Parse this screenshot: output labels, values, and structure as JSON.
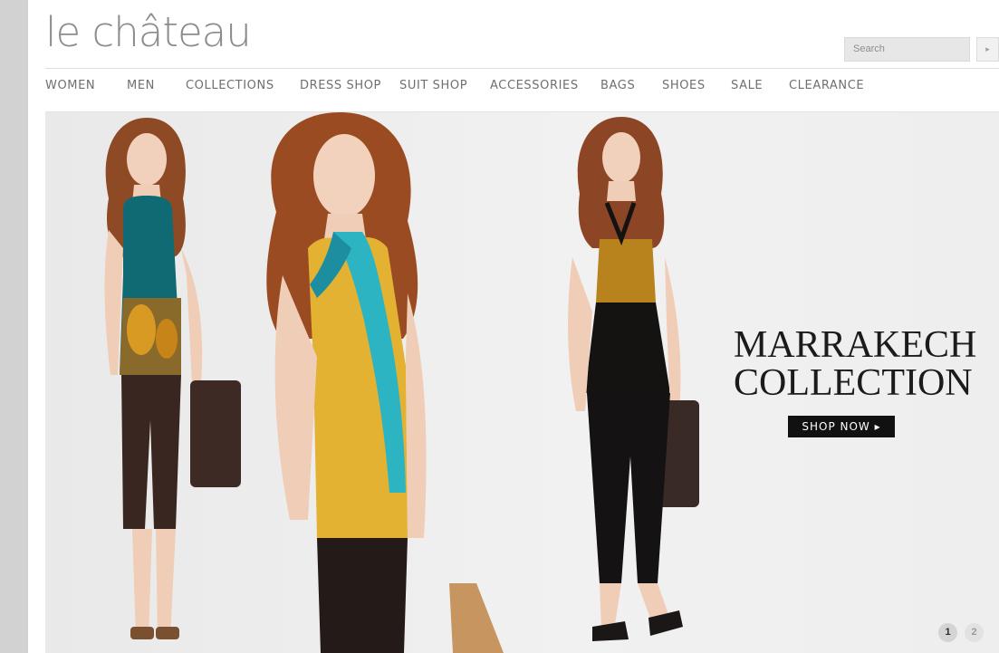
{
  "brand": {
    "logo_text": "le château"
  },
  "search": {
    "placeholder": "Search",
    "submit_glyph": "▸"
  },
  "nav": {
    "items": [
      {
        "label": "WOMEN"
      },
      {
        "label": "MEN"
      },
      {
        "label": "COLLECTIONS"
      },
      {
        "label": "DRESS SHOP"
      },
      {
        "label": "SUIT SHOP"
      },
      {
        "label": "ACCESSORIES"
      },
      {
        "label": "BAGS"
      },
      {
        "label": "SHOES"
      },
      {
        "label": "SALE"
      },
      {
        "label": "CLEARANCE"
      }
    ]
  },
  "hero": {
    "title_line1": "MARRAKECH",
    "title_line2": "COLLECTION",
    "cta_label": "SHOP NOW ▸",
    "pager": {
      "page1": "1",
      "page2": "2",
      "active": "1"
    }
  },
  "colors": {
    "logo": "#8c8c8c",
    "nav_text": "#6f6f6f",
    "cta_bg": "#111111",
    "teal_top": "#0f6a74",
    "mustard": "#e3b232",
    "scarf": "#2db4c2"
  }
}
